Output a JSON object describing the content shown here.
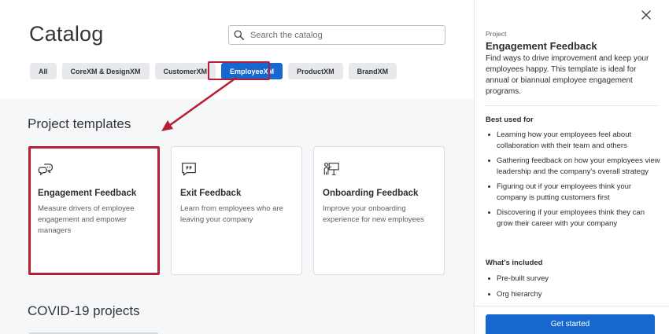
{
  "page": {
    "title": "Catalog"
  },
  "search": {
    "placeholder": "Search the catalog"
  },
  "filters": [
    {
      "label": "All",
      "active": false
    },
    {
      "label": "CoreXM & DesignXM",
      "active": false
    },
    {
      "label": "CustomerXM",
      "active": false
    },
    {
      "label": "EmployeeXM",
      "active": true
    },
    {
      "label": "ProductXM",
      "active": false
    },
    {
      "label": "BrandXM",
      "active": false
    }
  ],
  "sections": {
    "templates_title": "Project templates",
    "covid_title": "COVID-19 projects"
  },
  "cards": [
    {
      "icon": "chat-bubbles-icon",
      "title": "Engagement Feedback",
      "description": "Measure drivers of employee engagement and empower managers",
      "highlighted": true
    },
    {
      "icon": "quote-bubble-icon",
      "title": "Exit Feedback",
      "description": "Learn from employees who are leaving your company",
      "highlighted": false
    },
    {
      "icon": "presenter-icon",
      "title": "Onboarding Feedback",
      "description": "Improve your onboarding experience for new employees",
      "highlighted": false
    }
  ],
  "panel": {
    "eyebrow": "Project",
    "title": "Engagement Feedback",
    "description": "Find ways to drive improvement and keep your employees happy. This template is ideal for annual or biannual employee engagement programs.",
    "best_used_label": "Best used for",
    "best_used": [
      "Learning how your employees feel about collaboration with their team and others",
      "Gathering feedback on how your employees view leadership and the company's overall strategy",
      "Figuring out if your employees think your company is putting customers first",
      "Discovering if your employees think they can grow their career with your company"
    ],
    "included_label": "What's included",
    "included": [
      "Pre-built survey",
      "Org hierarchy"
    ],
    "cta": "Get started"
  },
  "colors": {
    "accent": "#1668d0",
    "highlight": "#b51e35"
  }
}
